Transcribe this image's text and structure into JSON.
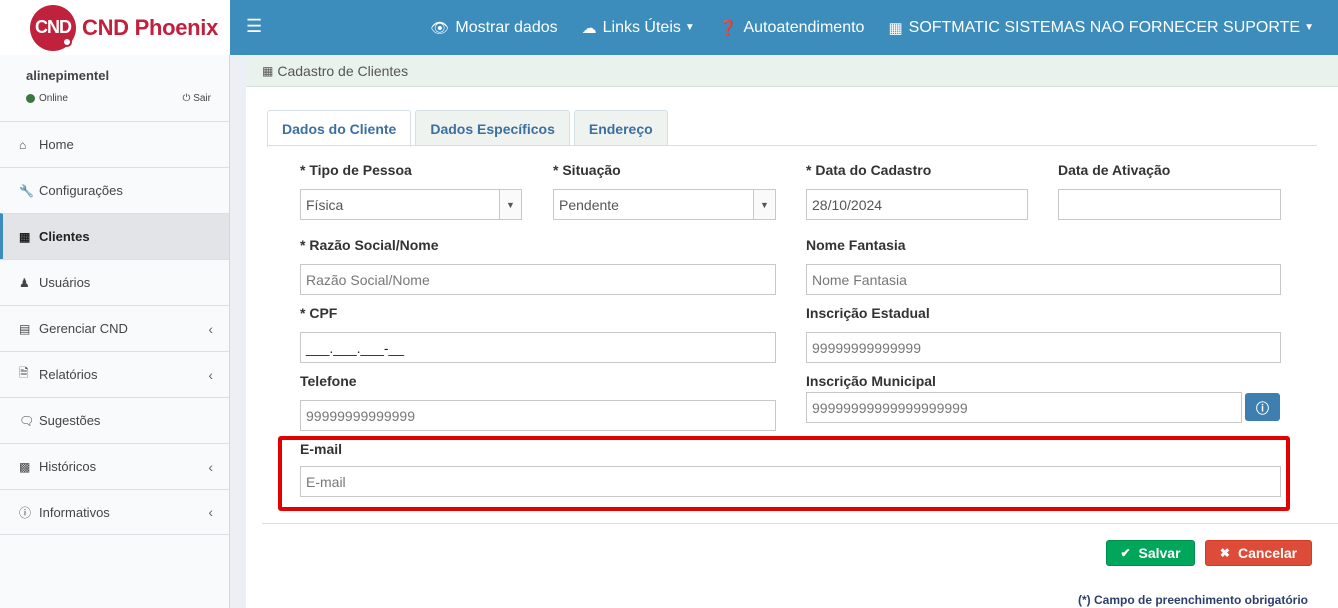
{
  "brand": {
    "badge": "CND",
    "name": "CND Phoenix",
    "color": "#c0213d"
  },
  "topbar": {
    "color": "#3c8dbc",
    "items": [
      {
        "label": "Mostrar dados",
        "icon": "eye-icon"
      },
      {
        "label": "Links Úteis",
        "icon": "cloud-icon",
        "dropdown": true
      },
      {
        "label": "Autoatendimento",
        "icon": "question-circle-icon"
      },
      {
        "label": "SOFTMATIC SISTEMAS NAO FORNECER SUPORTE",
        "icon": "building-icon",
        "dropdown": true
      }
    ]
  },
  "user": {
    "name": "alinepimentel",
    "status": "Online",
    "logout": "Sair"
  },
  "sidebar": {
    "items": [
      {
        "label": "Home",
        "icon": "home-icon"
      },
      {
        "label": "Configurações",
        "icon": "wrench-icon"
      },
      {
        "label": "Clientes",
        "icon": "building-icon",
        "active": true
      },
      {
        "label": "Usuários",
        "icon": "user-icon"
      },
      {
        "label": "Gerenciar CND",
        "icon": "calendar-icon",
        "expandable": true
      },
      {
        "label": "Relatórios",
        "icon": "file-icon",
        "expandable": true
      },
      {
        "label": "Sugestões",
        "icon": "comments-icon"
      },
      {
        "label": "Históricos",
        "icon": "archive-icon",
        "expandable": true
      },
      {
        "label": "Informativos",
        "icon": "info-circle-icon",
        "expandable": true
      }
    ]
  },
  "page": {
    "title": "Cadastro de Clientes"
  },
  "tabs": [
    {
      "label": "Dados do Cliente",
      "active": true
    },
    {
      "label": "Dados Específicos"
    },
    {
      "label": "Endereço"
    }
  ],
  "form": {
    "tipo_pessoa": {
      "label": "* Tipo de Pessoa",
      "value": "Física"
    },
    "situacao": {
      "label": "* Situação",
      "value": "Pendente"
    },
    "data_cadastro": {
      "label": "* Data do Cadastro",
      "value": "28/10/2024"
    },
    "data_ativacao": {
      "label": "Data de Ativação",
      "value": ""
    },
    "razao_social": {
      "label": "* Razão Social/Nome",
      "placeholder": "Razão Social/Nome"
    },
    "nome_fantasia": {
      "label": "Nome Fantasia",
      "placeholder": "Nome Fantasia"
    },
    "cpf": {
      "label": "* CPF",
      "value": "___.___.___-__"
    },
    "inscricao_estadual": {
      "label": "Inscrição Estadual",
      "placeholder": "99999999999999"
    },
    "telefone": {
      "label": "Telefone",
      "placeholder": "99999999999999"
    },
    "inscricao_municipal": {
      "label": "Inscrição Municipal",
      "placeholder": "99999999999999999999"
    },
    "email": {
      "label": "E-mail",
      "placeholder": "E-mail"
    }
  },
  "actions": {
    "save": "Salvar",
    "cancel": "Cancelar"
  },
  "footer_note": "(*) Campo de preenchimento obrigatório"
}
